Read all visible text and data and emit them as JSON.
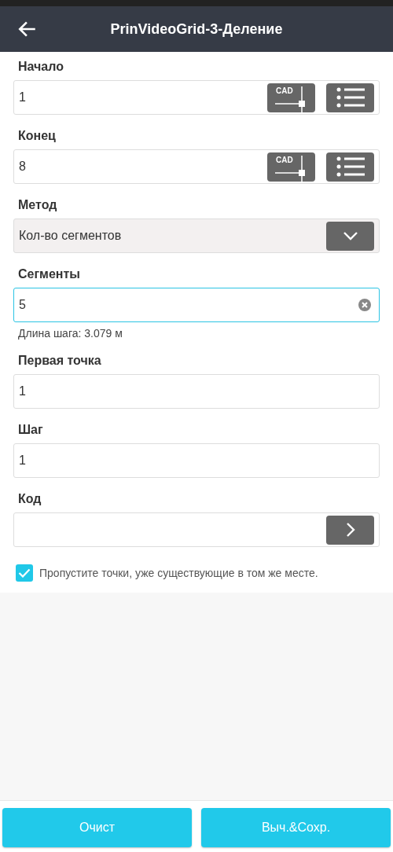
{
  "header": {
    "title": "PrinVideoGrid-3-Деление"
  },
  "fields": [
    {
      "label": "Начало",
      "kind": "text",
      "value": "1",
      "focused": false,
      "buttons": [
        {
          "kind": "cad",
          "label": "CAD"
        },
        {
          "kind": "list"
        }
      ]
    },
    {
      "label": "Конец",
      "kind": "text",
      "value": "8",
      "focused": false,
      "buttons": [
        {
          "kind": "cad",
          "label": "CAD"
        },
        {
          "kind": "list"
        }
      ]
    },
    {
      "label": "Метод",
      "kind": "select",
      "value": "Кол-во сегментов",
      "focused": false
    },
    {
      "label": "Сегменты",
      "kind": "text",
      "value": "5",
      "focused": true,
      "clearable": true,
      "hint": "Длина шага: 3.079 м"
    },
    {
      "label": "Первая точка",
      "kind": "text",
      "value": "1",
      "focused": false
    },
    {
      "label": "Шаг",
      "kind": "text",
      "value": "1",
      "focused": false
    },
    {
      "label": "Код",
      "kind": "picker",
      "focused": false
    }
  ],
  "skip_existing": {
    "label": "Пропустите точки, уже существующие в том же месте.",
    "checked": true
  },
  "buttons": [
    "Очист",
    "Выч.&Сохр."
  ]
}
